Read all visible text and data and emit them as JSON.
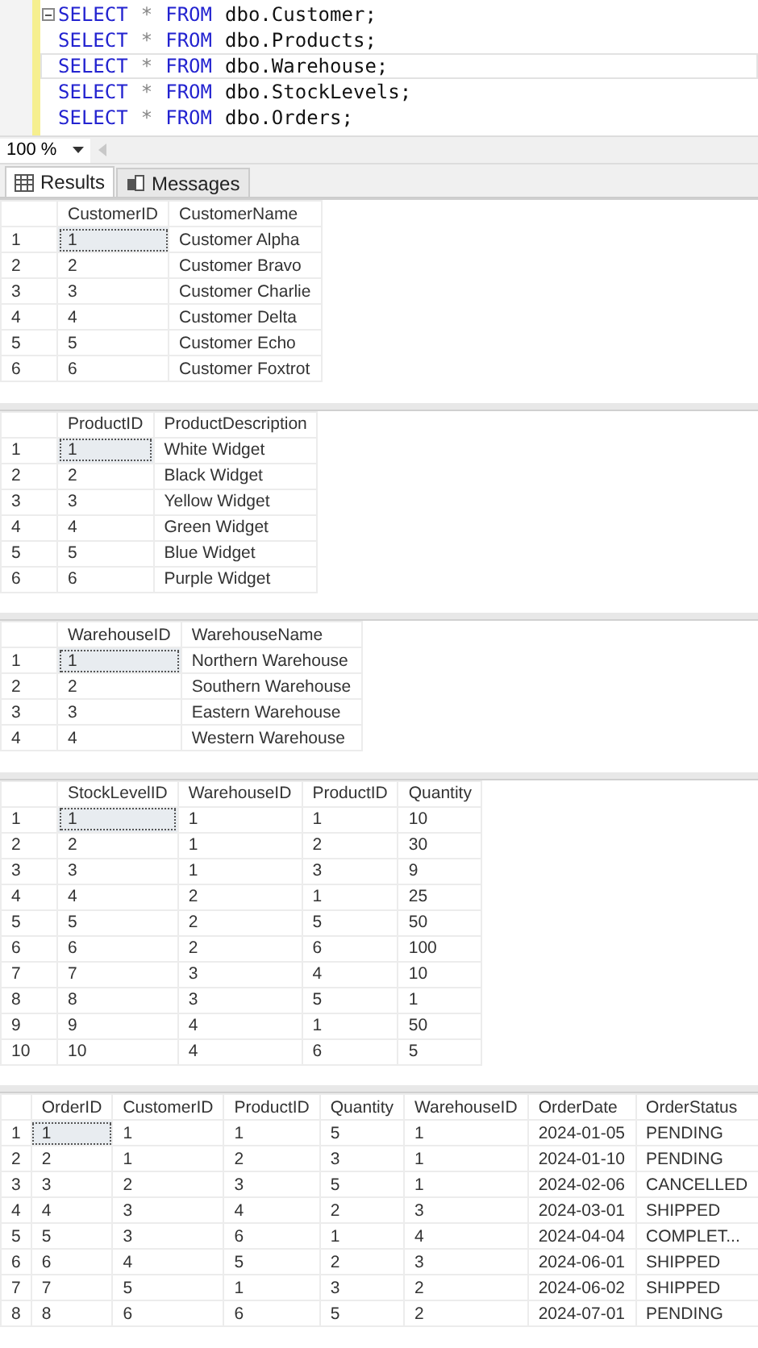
{
  "editor": {
    "lines": [
      {
        "collapsible": true,
        "current": false,
        "tokens": [
          {
            "kind": "keyword",
            "text": "SELECT"
          },
          {
            "kind": "operator",
            "text": "*"
          },
          {
            "kind": "keyword",
            "text": "FROM"
          },
          {
            "kind": "identifier",
            "text": "dbo.Customer;"
          }
        ]
      },
      {
        "collapsible": false,
        "current": false,
        "tokens": [
          {
            "kind": "keyword",
            "text": "SELECT"
          },
          {
            "kind": "operator",
            "text": "*"
          },
          {
            "kind": "keyword",
            "text": "FROM"
          },
          {
            "kind": "identifier",
            "text": "dbo.Products;"
          }
        ]
      },
      {
        "collapsible": false,
        "current": true,
        "tokens": [
          {
            "kind": "keyword",
            "text": "SELECT"
          },
          {
            "kind": "operator",
            "text": "*"
          },
          {
            "kind": "keyword",
            "text": "FROM"
          },
          {
            "kind": "identifier",
            "text": "dbo.Warehouse;"
          }
        ]
      },
      {
        "collapsible": false,
        "current": false,
        "tokens": [
          {
            "kind": "keyword",
            "text": "SELECT"
          },
          {
            "kind": "operator",
            "text": "*"
          },
          {
            "kind": "keyword",
            "text": "FROM"
          },
          {
            "kind": "identifier",
            "text": "dbo.StockLevels;"
          }
        ]
      },
      {
        "collapsible": false,
        "current": false,
        "tokens": [
          {
            "kind": "keyword",
            "text": "SELECT"
          },
          {
            "kind": "operator",
            "text": "*"
          },
          {
            "kind": "keyword",
            "text": "FROM"
          },
          {
            "kind": "identifier",
            "text": "dbo.Orders;"
          }
        ]
      }
    ]
  },
  "zoom": {
    "value": "100 %"
  },
  "tabs": [
    {
      "label": "Results",
      "selected": true
    },
    {
      "label": "Messages",
      "selected": false
    }
  ],
  "grids": [
    {
      "columns": [
        "CustomerID",
        "CustomerName"
      ],
      "rows": [
        {
          "number": "1",
          "focused": true,
          "cells": [
            "1",
            "Customer Alpha"
          ]
        },
        {
          "number": "2",
          "focused": false,
          "cells": [
            "2",
            "Customer Bravo"
          ]
        },
        {
          "number": "3",
          "focused": false,
          "cells": [
            "3",
            "Customer Charlie"
          ]
        },
        {
          "number": "4",
          "focused": false,
          "cells": [
            "4",
            "Customer Delta"
          ]
        },
        {
          "number": "5",
          "focused": false,
          "cells": [
            "5",
            "Customer Echo"
          ]
        },
        {
          "number": "6",
          "focused": false,
          "cells": [
            "6",
            "Customer Foxtrot"
          ]
        }
      ]
    },
    {
      "columns": [
        "ProductID",
        "ProductDescription"
      ],
      "rows": [
        {
          "number": "1",
          "focused": true,
          "cells": [
            "1",
            "White Widget"
          ]
        },
        {
          "number": "2",
          "focused": false,
          "cells": [
            "2",
            "Black Widget"
          ]
        },
        {
          "number": "3",
          "focused": false,
          "cells": [
            "3",
            "Yellow Widget"
          ]
        },
        {
          "number": "4",
          "focused": false,
          "cells": [
            "4",
            "Green Widget"
          ]
        },
        {
          "number": "5",
          "focused": false,
          "cells": [
            "5",
            "Blue Widget"
          ]
        },
        {
          "number": "6",
          "focused": false,
          "cells": [
            "6",
            "Purple Widget"
          ]
        }
      ]
    },
    {
      "columns": [
        "WarehouseID",
        "WarehouseName"
      ],
      "rows": [
        {
          "number": "1",
          "focused": true,
          "cells": [
            "1",
            "Northern Warehouse"
          ]
        },
        {
          "number": "2",
          "focused": false,
          "cells": [
            "2",
            "Southern Warehouse"
          ]
        },
        {
          "number": "3",
          "focused": false,
          "cells": [
            "3",
            "Eastern Warehouse"
          ]
        },
        {
          "number": "4",
          "focused": false,
          "cells": [
            "4",
            "Western Warehouse"
          ]
        }
      ]
    },
    {
      "columns": [
        "StockLevelID",
        "WarehouseID",
        "ProductID",
        "Quantity"
      ],
      "rows": [
        {
          "number": "1",
          "focused": true,
          "cells": [
            "1",
            "1",
            "1",
            "10"
          ]
        },
        {
          "number": "2",
          "focused": false,
          "cells": [
            "2",
            "1",
            "2",
            "30"
          ]
        },
        {
          "number": "3",
          "focused": false,
          "cells": [
            "3",
            "1",
            "3",
            "9"
          ]
        },
        {
          "number": "4",
          "focused": false,
          "cells": [
            "4",
            "2",
            "1",
            "25"
          ]
        },
        {
          "number": "5",
          "focused": false,
          "cells": [
            "5",
            "2",
            "5",
            "50"
          ]
        },
        {
          "number": "6",
          "focused": false,
          "cells": [
            "6",
            "2",
            "6",
            "100"
          ]
        },
        {
          "number": "7",
          "focused": false,
          "cells": [
            "7",
            "3",
            "4",
            "10"
          ]
        },
        {
          "number": "8",
          "focused": false,
          "cells": [
            "8",
            "3",
            "5",
            "1"
          ]
        },
        {
          "number": "9",
          "focused": false,
          "cells": [
            "9",
            "4",
            "1",
            "50"
          ]
        },
        {
          "number": "10",
          "focused": false,
          "cells": [
            "10",
            "4",
            "6",
            "5"
          ]
        }
      ]
    },
    {
      "columns": [
        "OrderID",
        "CustomerID",
        "ProductID",
        "Quantity",
        "WarehouseID",
        "OrderDate",
        "OrderStatus"
      ],
      "rows": [
        {
          "number": "1",
          "focused": true,
          "cells": [
            "1",
            "1",
            "1",
            "5",
            "1",
            "2024-01-05",
            "PENDING"
          ]
        },
        {
          "number": "2",
          "focused": false,
          "cells": [
            "2",
            "1",
            "2",
            "3",
            "1",
            "2024-01-10",
            "PENDING"
          ]
        },
        {
          "number": "3",
          "focused": false,
          "cells": [
            "3",
            "2",
            "3",
            "5",
            "1",
            "2024-02-06",
            "CANCELLED"
          ]
        },
        {
          "number": "4",
          "focused": false,
          "cells": [
            "4",
            "3",
            "4",
            "2",
            "3",
            "2024-03-01",
            "SHIPPED"
          ]
        },
        {
          "number": "5",
          "focused": false,
          "cells": [
            "5",
            "3",
            "6",
            "1",
            "4",
            "2024-04-04",
            "COMPLET..."
          ]
        },
        {
          "number": "6",
          "focused": false,
          "cells": [
            "6",
            "4",
            "5",
            "2",
            "3",
            "2024-06-01",
            "SHIPPED"
          ]
        },
        {
          "number": "7",
          "focused": false,
          "cells": [
            "7",
            "5",
            "1",
            "3",
            "2",
            "2024-06-02",
            "SHIPPED"
          ]
        },
        {
          "number": "8",
          "focused": false,
          "cells": [
            "8",
            "6",
            "6",
            "5",
            "2",
            "2024-07-01",
            "PENDING"
          ]
        }
      ]
    }
  ]
}
